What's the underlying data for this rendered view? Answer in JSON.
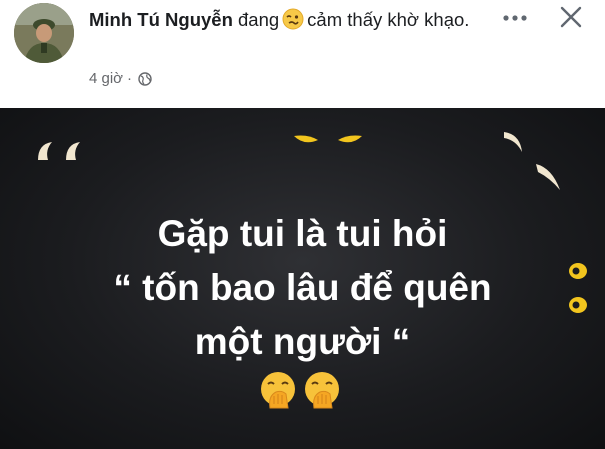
{
  "post": {
    "author": "Minh Tú Nguyễn",
    "feeling_prefix": "đang",
    "feeling_text": "cảm thấy khờ khạo.",
    "time": "4 giờ",
    "separator": "·"
  },
  "image": {
    "line1": "Gặp tui là tui hỏi",
    "line2": "“ tốn bao lâu để quên",
    "line3": "một người “"
  },
  "icons": {
    "feeling": "woozy-face-emoji",
    "privacy": "globe-icon",
    "more": "more-options-icon",
    "close": "close-icon",
    "emoji": "face-with-hand-over-mouth-emoji"
  },
  "colors": {
    "author": "#1c1e21",
    "meta": "#65676b",
    "image_bg": "#1b1c1f",
    "eyes": "#f2c51e"
  }
}
